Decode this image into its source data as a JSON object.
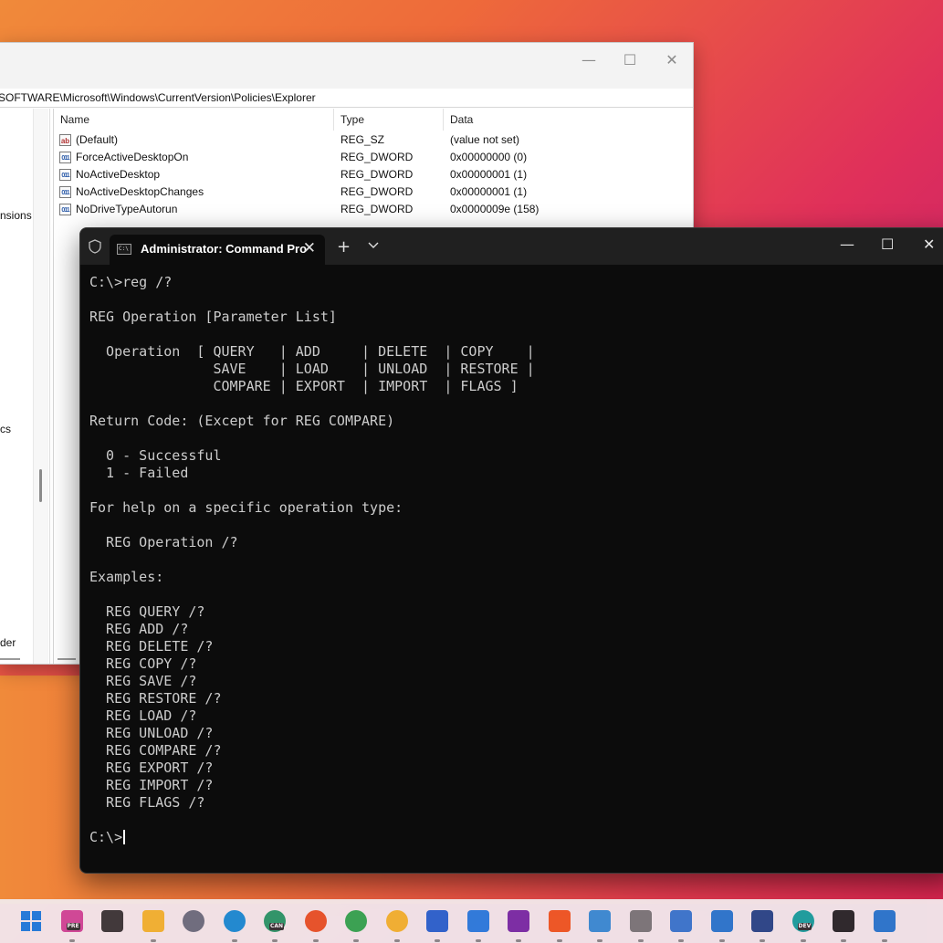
{
  "regedit": {
    "address": "SOFTWARE\\Microsoft\\Windows\\CurrentVersion\\Policies\\Explorer",
    "minimize": "—",
    "maximize": "☐",
    "close": "✕",
    "tree_items": [
      {
        "label": "nsions"
      },
      {
        "label": "cs"
      },
      {
        "label": "der"
      }
    ],
    "columns": {
      "name": "Name",
      "type": "Type",
      "data": "Data"
    },
    "values": [
      {
        "icon": "ab",
        "name": "(Default)",
        "type": "REG_SZ",
        "data": "(value not set)"
      },
      {
        "icon": "011",
        "name": "ForceActiveDesktopOn",
        "type": "REG_DWORD",
        "data": "0x00000000 (0)"
      },
      {
        "icon": "011",
        "name": "NoActiveDesktop",
        "type": "REG_DWORD",
        "data": "0x00000001 (1)"
      },
      {
        "icon": "011",
        "name": "NoActiveDesktopChanges",
        "type": "REG_DWORD",
        "data": "0x00000001 (1)"
      },
      {
        "icon": "011",
        "name": "NoDriveTypeAutorun",
        "type": "REG_DWORD",
        "data": "0x0000009e (158)"
      }
    ]
  },
  "terminal": {
    "tab_title": "Administrator: Command Pro",
    "tab_icon_text": "C:\\",
    "tab_close": "✕",
    "new_tab": "+",
    "minimize": "—",
    "maximize": "☐",
    "close": "✕",
    "lines": [
      "C:\\>reg /?",
      "",
      "REG Operation [Parameter List]",
      "",
      "  Operation  [ QUERY   | ADD     | DELETE  | COPY    |",
      "               SAVE    | LOAD    | UNLOAD  | RESTORE |",
      "               COMPARE | EXPORT  | IMPORT  | FLAGS ]",
      "",
      "Return Code: (Except for REG COMPARE)",
      "",
      "  0 - Successful",
      "  1 - Failed",
      "",
      "For help on a specific operation type:",
      "",
      "  REG Operation /?",
      "",
      "Examples:",
      "",
      "  REG QUERY /?",
      "  REG ADD /?",
      "  REG DELETE /?",
      "  REG COPY /?",
      "  REG SAVE /?",
      "  REG RESTORE /?",
      "  REG LOAD /?",
      "  REG UNLOAD /?",
      "  REG COMPARE /?",
      "  REG EXPORT /?",
      "  REG IMPORT /?",
      "  REG FLAGS /?",
      ""
    ],
    "prompt": "C:\\>"
  },
  "taskbar": {
    "icons": [
      {
        "name": "start-icon",
        "color": "#1e7ee0"
      },
      {
        "name": "copilot-pre-icon",
        "color": "#d04a9a",
        "badge": "PRE"
      },
      {
        "name": "task-view-icon",
        "color": "#3a3a3a"
      },
      {
        "name": "file-explorer-icon",
        "color": "#f2b632"
      },
      {
        "name": "settings-icon",
        "color": "#6b7180"
      },
      {
        "name": "edge-icon",
        "color": "#1a8fd6"
      },
      {
        "name": "edge-canary-icon",
        "color": "#2a9a6a",
        "badge": "CAN"
      },
      {
        "name": "firefox-icon",
        "color": "#e8562a"
      },
      {
        "name": "chrome-icon",
        "color": "#35a853"
      },
      {
        "name": "chrome-canary-icon",
        "color": "#f2b632"
      },
      {
        "name": "store-icon",
        "color": "#2a66d0"
      },
      {
        "name": "todo-icon",
        "color": "#2b7fe0"
      },
      {
        "name": "onenote-icon",
        "color": "#7a2fa8"
      },
      {
        "name": "brave-icon",
        "color": "#f05a24"
      },
      {
        "name": "notepad-icon",
        "color": "#3a8fd6"
      },
      {
        "name": "app-icon",
        "color": "#7a7a7a"
      },
      {
        "name": "remote-desktop-icon",
        "color": "#3a7ad0"
      },
      {
        "name": "photos-icon",
        "color": "#2a7ad0"
      },
      {
        "name": "system-app-icon",
        "color": "#2a4a8a"
      },
      {
        "name": "edge-dev-icon",
        "color": "#1aa3a0",
        "badge": "DEV"
      },
      {
        "name": "terminal-icon",
        "color": "#2a2a2a"
      },
      {
        "name": "dev-tool-icon",
        "color": "#2a7ad0"
      }
    ]
  }
}
